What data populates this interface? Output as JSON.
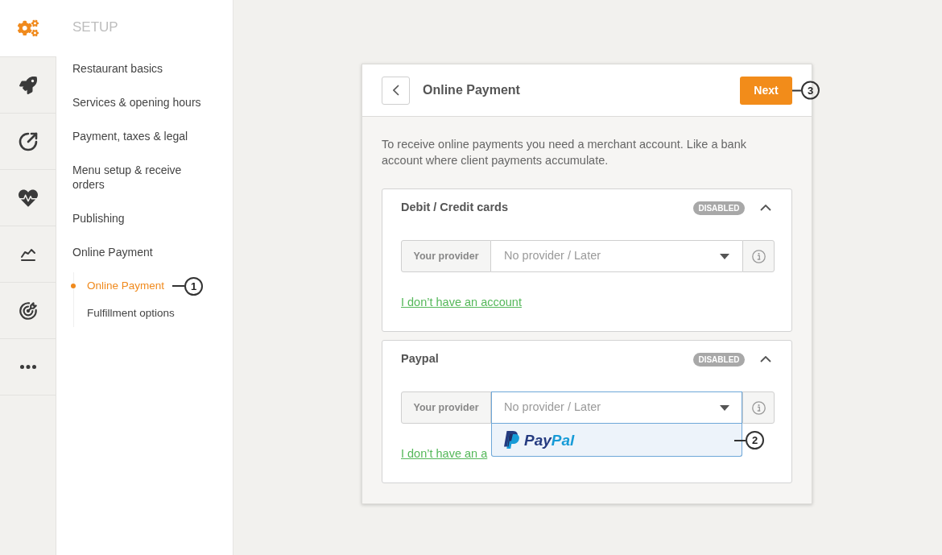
{
  "sidebar": {
    "title": "SETUP",
    "items": [
      {
        "label": "Restaurant basics"
      },
      {
        "label": "Services & opening hours"
      },
      {
        "label": "Payment, taxes & legal"
      },
      {
        "label": "Menu setup & receive orders"
      },
      {
        "label": "Publishing"
      },
      {
        "label": "Online Payment",
        "children": [
          {
            "label": "Online Payment",
            "selected": true,
            "callout": "1"
          },
          {
            "label": "Fulfillment options",
            "selected": false
          }
        ]
      }
    ]
  },
  "card": {
    "title": "Online Payment",
    "next_button": {
      "label": "Next",
      "callout": "3"
    },
    "description": "To receive online payments you need a merchant account. Like a bank account where client payments accumulate.",
    "sections": [
      {
        "title": "Debit / Credit cards",
        "badge": "DISABLED",
        "expanded": true,
        "provider": {
          "label": "Your provider",
          "value": "No provider / Later",
          "open": false
        },
        "link": "I don’t have an account"
      },
      {
        "title": "Paypal",
        "badge": "DISABLED",
        "expanded": true,
        "provider": {
          "label": "Your provider",
          "value": "No provider / Later",
          "open": true,
          "options": [
            {
              "wordmark": [
                {
                  "text": "Pay",
                  "color": "#253b80"
                },
                {
                  "text": "Pal",
                  "color": "#179bd7"
                }
              ],
              "highlighted": true,
              "callout": "2"
            }
          ]
        },
        "link": "I don’t have an a"
      }
    ]
  }
}
